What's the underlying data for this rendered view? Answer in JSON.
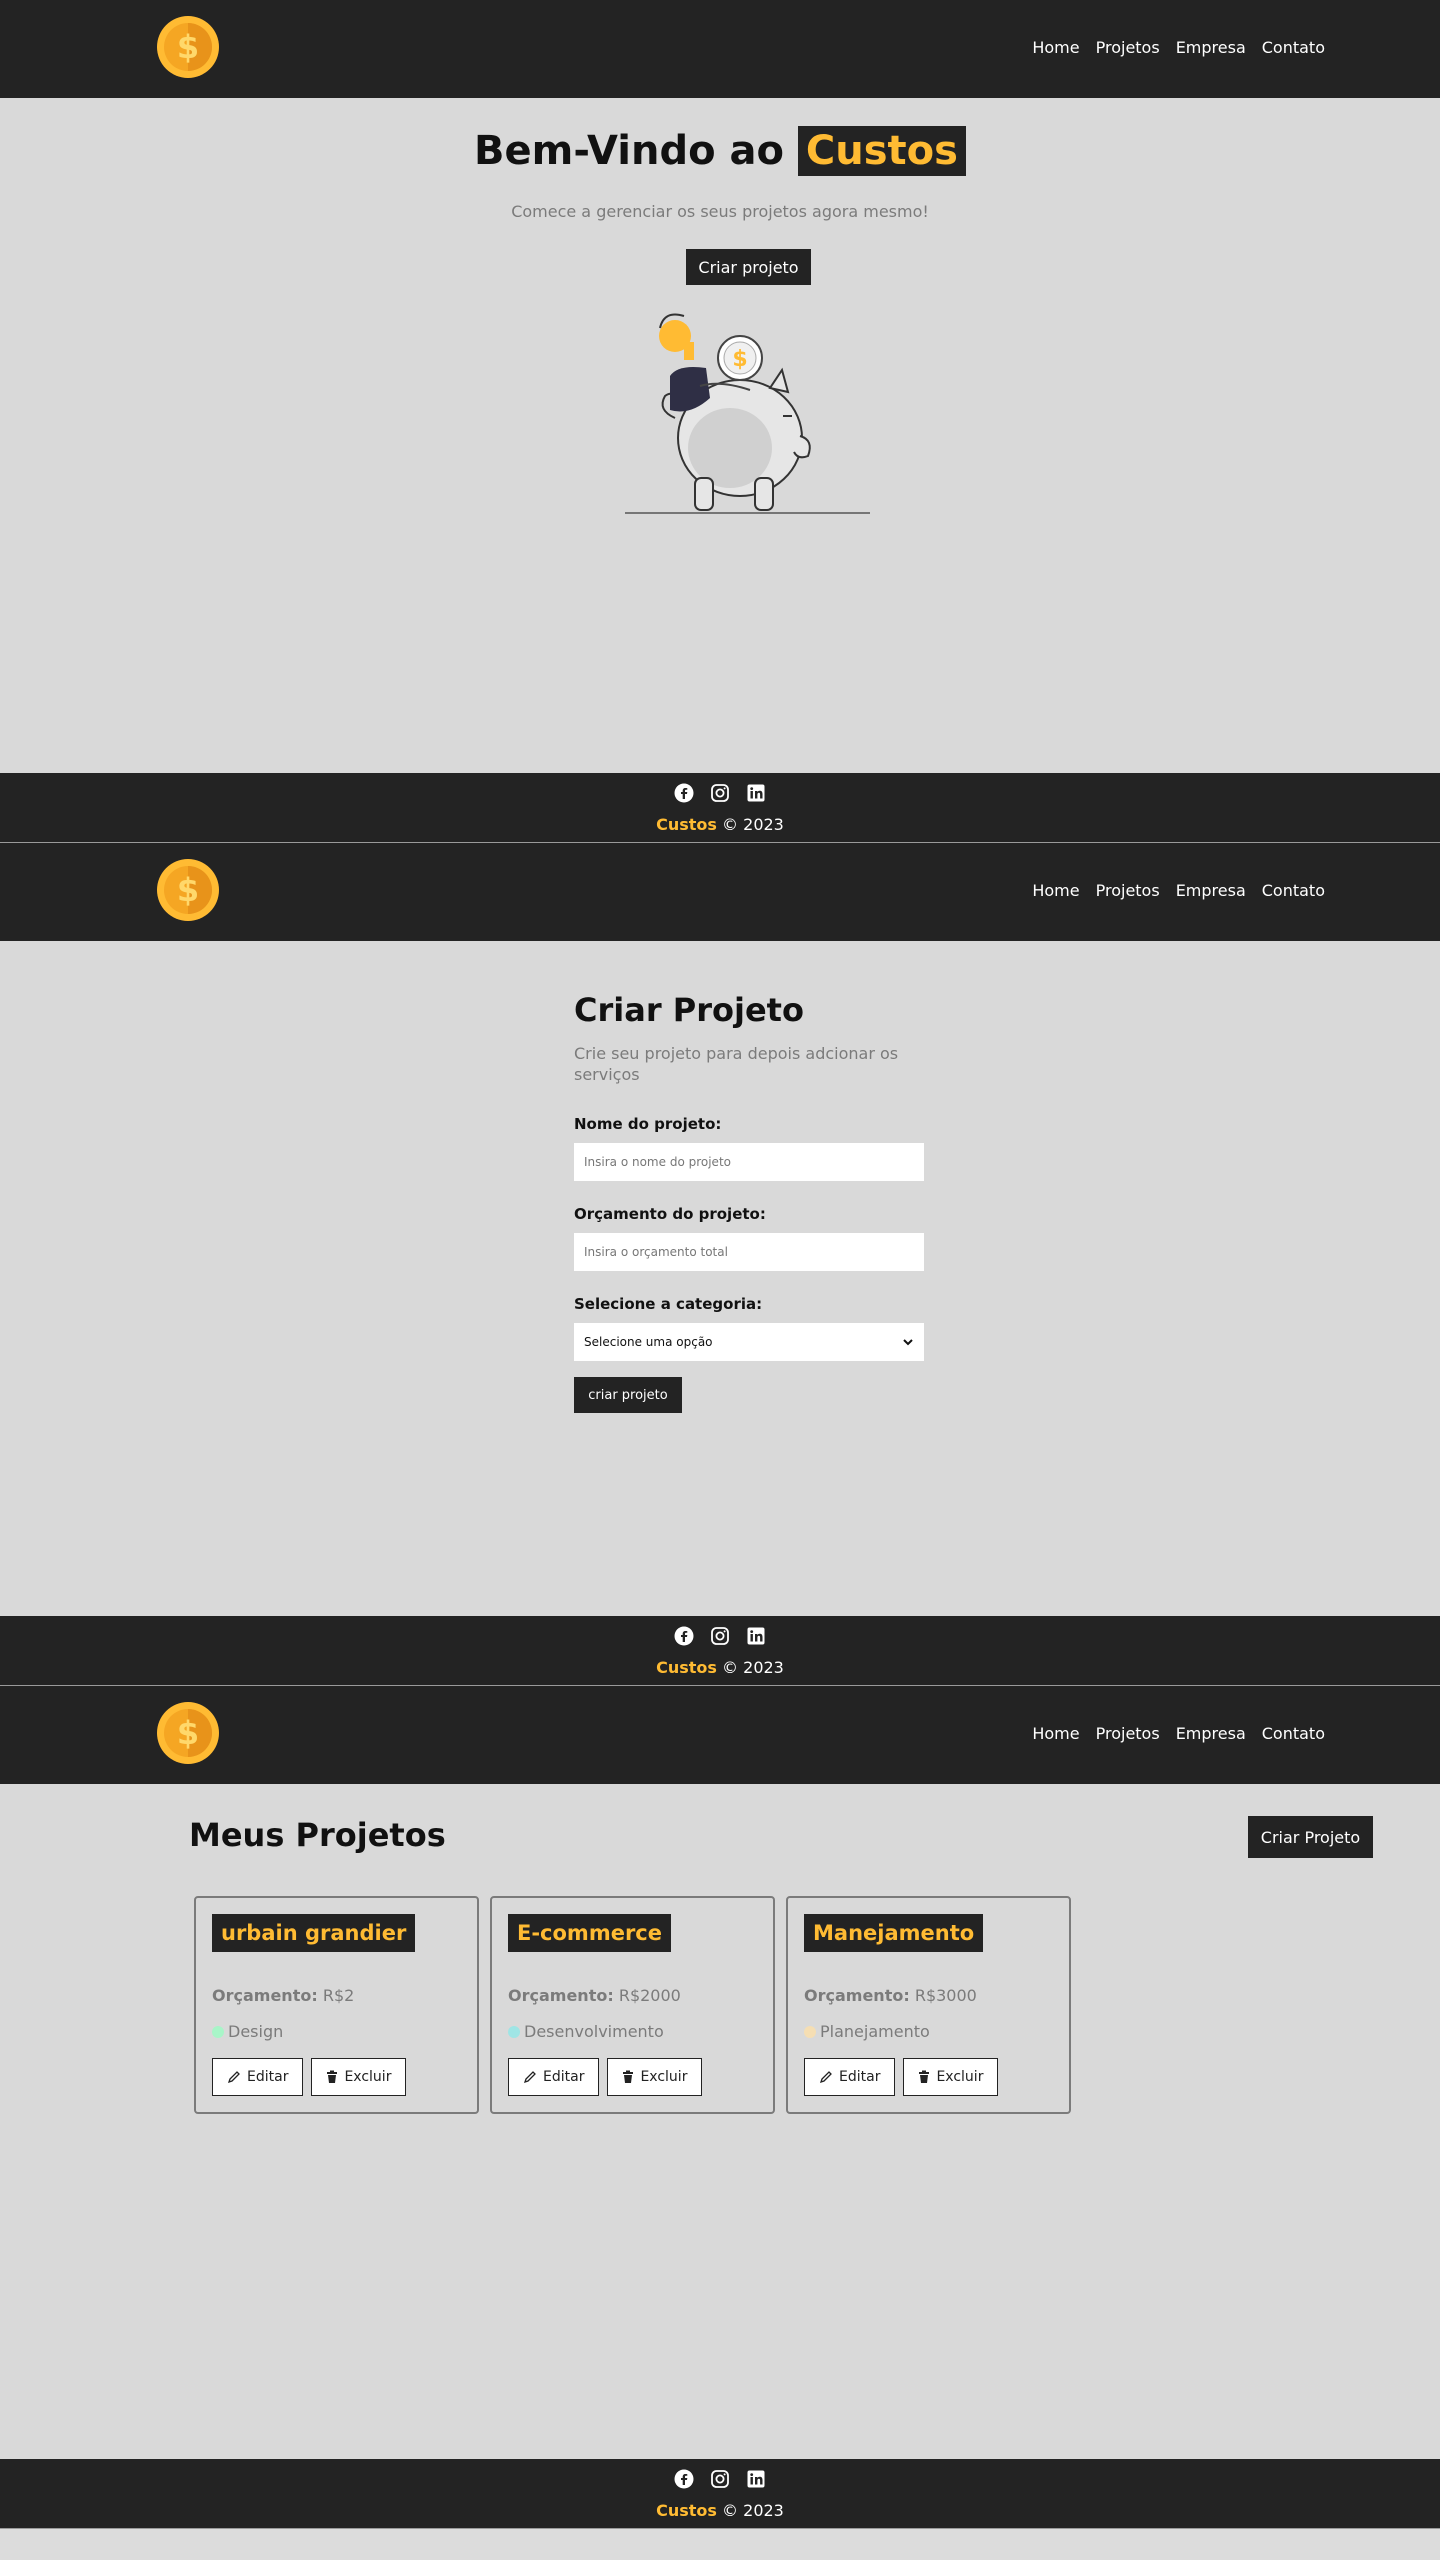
{
  "nav": {
    "links": [
      "Home",
      "Projetos",
      "Empresa",
      "Contato"
    ]
  },
  "footer": {
    "brand": "Custos",
    "copyright": "© 2023",
    "social_icons": [
      "facebook-icon",
      "instagram-icon",
      "linkedin-icon"
    ]
  },
  "home": {
    "title_prefix": "Bem-Vindo ao",
    "title_highlight": "Custos",
    "subtitle": "Comece a gerenciar os seus projetos agora mesmo!",
    "button": "Criar projeto"
  },
  "create": {
    "title": "Criar Projeto",
    "subtitle": "Crie seu projeto para depois adcionar os serviços",
    "name_label": "Nome do projeto:",
    "name_placeholder": "Insira o nome do projeto",
    "budget_label": "Orçamento do projeto:",
    "budget_placeholder": "Insira o orçamento total",
    "category_label": "Selecione a categoria:",
    "category_selected": "Selecione uma opção",
    "submit": "criar projeto"
  },
  "projects": {
    "title": "Meus Projetos",
    "create_button": "Criar Projeto",
    "budget_label": "Orçamento:",
    "edit_label": "Editar",
    "delete_label": "Excluir",
    "items": [
      {
        "name": "urbain grandier",
        "budget": "R$2",
        "category": "Design",
        "category_color": "#a8f5c8"
      },
      {
        "name": "E-commerce",
        "budget": "R$2000",
        "category": "Desenvolvimento",
        "category_color": "#9fe5e5"
      },
      {
        "name": "Manejamento",
        "budget": "R$3000",
        "category": "Planejamento",
        "category_color": "#f5deb3"
      }
    ]
  },
  "colors": {
    "accent": "#ffbb33",
    "dark": "#232323",
    "background": "#d9d9d9"
  }
}
